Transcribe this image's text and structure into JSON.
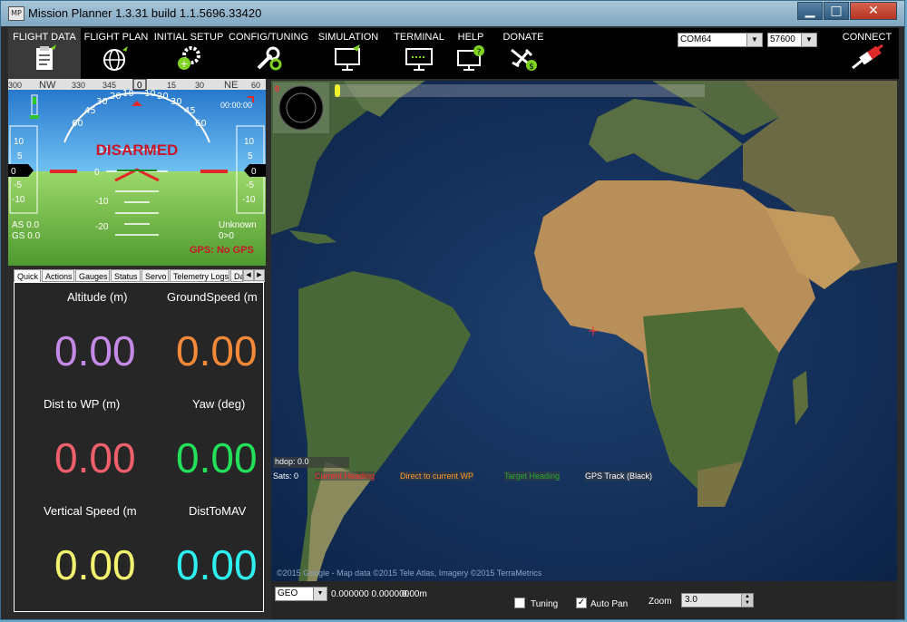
{
  "window": {
    "title": "Mission Planner 1.3.31 build 1.1.5696.33420",
    "app_icon_text": "MP"
  },
  "menu": [
    {
      "label": "FLIGHT DATA",
      "icon": "clipboard-icon"
    },
    {
      "label": "FLIGHT PLAN",
      "icon": "globe-icon"
    },
    {
      "label": "INITIAL SETUP",
      "icon": "gears-icon"
    },
    {
      "label": "CONFIG/TUNING",
      "icon": "wrench-icon"
    },
    {
      "label": "SIMULATION",
      "icon": "monitor-plane-icon"
    },
    {
      "label": "TERMINAL",
      "icon": "terminal-icon"
    },
    {
      "label": "HELP",
      "icon": "help-icon"
    },
    {
      "label": "DONATE",
      "icon": "donate-icon"
    }
  ],
  "connection": {
    "port": "COM64",
    "baud": "57600",
    "connect_label": "CONNECT"
  },
  "hud": {
    "heading_ticks": [
      "300",
      "NW",
      "330",
      "345",
      "0",
      "15",
      "30",
      "NE",
      "60"
    ],
    "heading_value": "0",
    "status": "DISARMED",
    "alt_value": "0",
    "speed_value": "0",
    "left_scale": [
      "10",
      "5",
      "0",
      "-5",
      "-10"
    ],
    "right_scale": [
      "10",
      "5",
      "0",
      "-5",
      "-10"
    ],
    "pitch_labels": [
      "10",
      "0",
      "-10",
      "-20"
    ],
    "bank_labels": [
      "60",
      "45",
      "30",
      "20",
      "10",
      "10",
      "20",
      "30",
      "45",
      "60"
    ],
    "as": "AS 0.0",
    "gs": "GS 0.0",
    "mode": "Unknown",
    "wp": "0>0",
    "gps": "GPS: No GPS",
    "timer": "00:00:00"
  },
  "tabs": [
    "Quick",
    "Actions",
    "Gauges",
    "Status",
    "Servo",
    "Telemetry Logs",
    "Da"
  ],
  "quick": [
    {
      "label": "Altitude (m)",
      "value": "0.00",
      "color": "#c58ae8"
    },
    {
      "label": "GroundSpeed (m",
      "value": "0.00",
      "color": "#f5893a"
    },
    {
      "label": "Dist to WP (m)",
      "value": "0.00",
      "color": "#f0606c"
    },
    {
      "label": "Yaw (deg)",
      "value": "0.00",
      "color": "#22e05a"
    },
    {
      "label": "Vertical Speed (m",
      "value": "0.00",
      "color": "#f3f26e"
    },
    {
      "label": "DistToMAV",
      "value": "0.00",
      "color": "#2ff0f0"
    }
  ],
  "map": {
    "compass_marker": "0",
    "hdop": "hdop: 0.0",
    "sats": "Sats: 0",
    "legend": [
      {
        "label": "Current Heading",
        "color": "#ff3030"
      },
      {
        "label": "Direct to current WP",
        "color": "#ff9a2a"
      },
      {
        "label": "Target Heading",
        "color": "#2aa82a"
      },
      {
        "label": "GPS Track (Black)",
        "color": "#ffffff"
      }
    ],
    "copyright": "©2015 Google - Map data ©2015 Tele Atlas, Imagery ©2015 TerraMetrics"
  },
  "statusbar": {
    "coord_type": "GEO",
    "coords": "0.000000 0.000000",
    "alt": "0.00m",
    "tuning_label": "Tuning",
    "tuning_checked": false,
    "autopan_label": "Auto Pan",
    "autopan_checked": true,
    "zoom_label": "Zoom",
    "zoom_value": "3.0"
  }
}
